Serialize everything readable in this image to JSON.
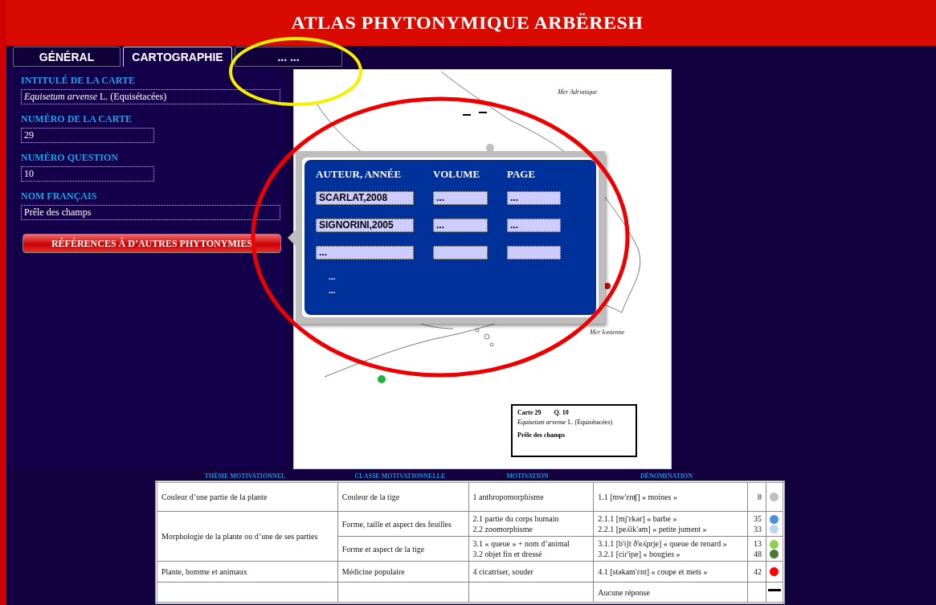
{
  "header": {
    "title": "ATLAS PHYTONYMIQUE ARBËRESH"
  },
  "tabs": [
    {
      "label": "GÉNÉRAL",
      "selected": false
    },
    {
      "label": "CARTOGRAPHIE",
      "selected": true
    },
    {
      "label": "... ...",
      "selected": false
    }
  ],
  "fields": [
    {
      "kind": "text",
      "label": "INTITULÉ DE LA CARTE",
      "value": "*Equisetum arvense* L. (Equisétacées)"
    },
    {
      "kind": "number",
      "label": "NUMÉRO DE LA CARTE",
      "value": "29"
    },
    {
      "kind": "number",
      "label": "NUMÉRO QUESTION",
      "value": "10"
    },
    {
      "kind": "text",
      "label": "NOM FRANÇAIS",
      "value": "Prêle des champs"
    }
  ],
  "references_button": {
    "label": "RÉFÉRENCES À D’AUTRES PHYTONYMIES"
  },
  "references_popup": {
    "columns": [
      "AUTEUR, ANNÉE",
      "VOLUME",
      "PAGE"
    ],
    "rows": [
      [
        "SCARLAT,2008",
        "...",
        "..."
      ],
      [
        "SIGNORINI,2005",
        "...",
        "..."
      ],
      [
        "...",
        null,
        null
      ]
    ],
    "more": [
      "...",
      "..."
    ]
  },
  "map": {
    "sea_labels": [
      "Mer Adriatique",
      "Mer Ionienne"
    ],
    "legend": {
      "map_number": "Carte 29",
      "question": "Q. 10",
      "title": "*Equisetum arvense* L. (Equisétacées)",
      "name": "Prêle des champs"
    }
  },
  "table": {
    "columns": [
      "THÈME MOTIVATIONNEL",
      "CLASSE MOTIVATIONNELLE",
      "MOTIVATION",
      "DÉNOMINATION"
    ],
    "groups": [
      {
        "theme": "Couleur d’une partie de la plante",
        "classes": [
          {
            "classe": "Couleur de la tige",
            "motivations": [
              "1 anthropomorphisme"
            ],
            "denominations": [
              {
                "kind": "dot",
                "text": "1.1 [mw'ɛnʧ] « moines »",
                "count": "8",
                "color": "#c0c0c0"
              }
            ]
          }
        ]
      },
      {
        "theme": "Morphologie de la plante ou d’une de ses parties",
        "classes": [
          {
            "classe": "Forme, taille et aspect des feuilles",
            "motivations": [
              "2.1 partie du corps humain",
              "2.2 zoomorphisme"
            ],
            "denominations": [
              {
                "kind": "dot",
                "text": "2.1.1 [mj'ɛkər] « barbe »",
                "count": "35",
                "color": "#4a90d9"
              },
              {
                "kind": "dot",
                "text": "2.2.1 [peʎik'əm] « petite jument »",
                "count": "33",
                "color": "#bcd7f0"
              }
            ]
          },
          {
            "classe": "Forme et aspect de la tige",
            "motivations": [
              "3.1 « queue » + nom d’animal",
              "3.2 objet fin et dressé"
            ],
            "denominations": [
              {
                "kind": "dot",
                "text": "3.1.1 [b'iʃt ð'eʎprje] « queue de renard »",
                "count": "13",
                "color": "#8fd14f"
              },
              {
                "kind": "dot",
                "text": "3.2.1 [ciɾ'iɲe] « bougies »",
                "count": "48",
                "color": "#4a7a30"
              }
            ]
          }
        ]
      },
      {
        "theme": "Plante, homme et animaux",
        "classes": [
          {
            "classe": "Médicine populaire",
            "motivations": [
              "4 cicatriser, souder"
            ],
            "denominations": [
              {
                "kind": "dot",
                "text": "4.1 [stəkam'ɛnt] « coupe et mets »",
                "count": "42",
                "color": "#ff0000"
              }
            ]
          }
        ]
      },
      {
        "classes": [
          {
            "denominations": [
              {
                "kind": "none",
                "text": "Aucune réponse"
              }
            ]
          }
        ]
      }
    ]
  }
}
